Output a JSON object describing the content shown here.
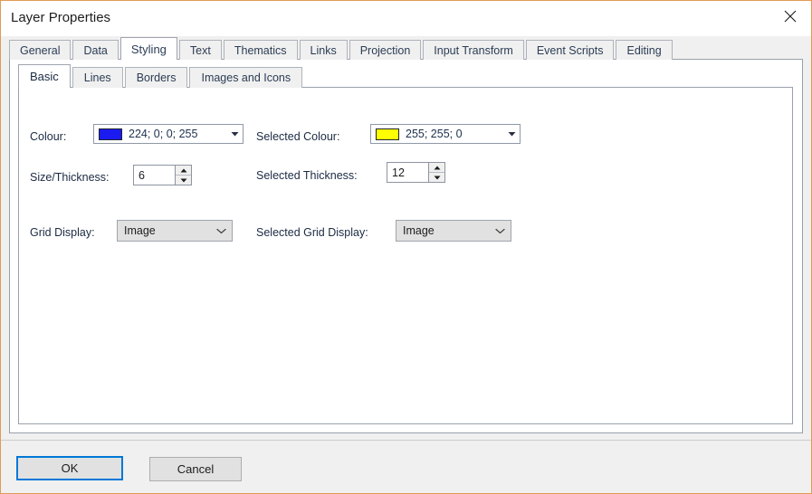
{
  "window": {
    "title": "Layer Properties",
    "close_icon": "close-icon",
    "accent_border": "#e09a54"
  },
  "tabs_outer": [
    {
      "label": "General",
      "active": false
    },
    {
      "label": "Data",
      "active": false
    },
    {
      "label": "Styling",
      "active": true
    },
    {
      "label": "Text",
      "active": false
    },
    {
      "label": "Thematics",
      "active": false
    },
    {
      "label": "Links",
      "active": false
    },
    {
      "label": "Projection",
      "active": false
    },
    {
      "label": "Input Transform",
      "active": false
    },
    {
      "label": "Event Scripts",
      "active": false
    },
    {
      "label": "Editing",
      "active": false
    }
  ],
  "tabs_inner": [
    {
      "label": "Basic",
      "active": true
    },
    {
      "label": "Lines",
      "active": false
    },
    {
      "label": "Borders",
      "active": false
    },
    {
      "label": "Images and Icons",
      "active": false
    }
  ],
  "form": {
    "colour": {
      "label": "Colour:",
      "value": "224; 0; 0; 255",
      "swatch_colour": "#1b1bf0",
      "arrow_icon": "chevron-down-solid-icon"
    },
    "selected_colour": {
      "label": "Selected Colour:",
      "value": "255; 255; 0",
      "swatch_colour": "#ffff00",
      "arrow_icon": "chevron-down-solid-icon"
    },
    "size_thickness": {
      "label": "Size/Thickness:",
      "value": "6",
      "up_icon": "spinner-up-icon",
      "down_icon": "spinner-down-icon"
    },
    "selected_thickness": {
      "label": "Selected Thickness:",
      "value": "12",
      "up_icon": "spinner-up-icon",
      "down_icon": "spinner-down-icon"
    },
    "grid_display": {
      "label": "Grid Display:",
      "value": "Image",
      "arrow_icon": "chevron-down-icon"
    },
    "selected_grid_display": {
      "label": "Selected Grid Display:",
      "value": "Image",
      "arrow_icon": "chevron-down-icon"
    }
  },
  "footer": {
    "ok_label": "OK",
    "cancel_label": "Cancel",
    "focus_colour": "#0078d7"
  }
}
